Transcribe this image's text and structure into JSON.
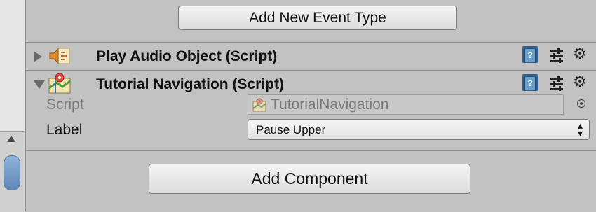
{
  "event_section": {
    "add_event_type_label": "Add New Event Type"
  },
  "components": [
    {
      "title": "Play Audio Object (Script)",
      "expanded": false,
      "icon": "audio-script-icon"
    },
    {
      "title": "Tutorial Navigation (Script)",
      "expanded": true,
      "icon": "map-script-icon",
      "properties": {
        "script_label": "Script",
        "script_value": "TutorialNavigation",
        "label_label": "Label",
        "label_value": "Pause Upper"
      }
    }
  ],
  "header_icons": {
    "help": "help-book-icon",
    "presets": "presets-icon",
    "settings": "gear-icon",
    "help_glyph": "?",
    "gear_glyph": "⚙"
  },
  "add_component_label": "Add Component",
  "colors": {
    "panel_bg": "#c2c2c2",
    "thumb": "#6f96c4",
    "help_blue": "#2f5f8f"
  }
}
